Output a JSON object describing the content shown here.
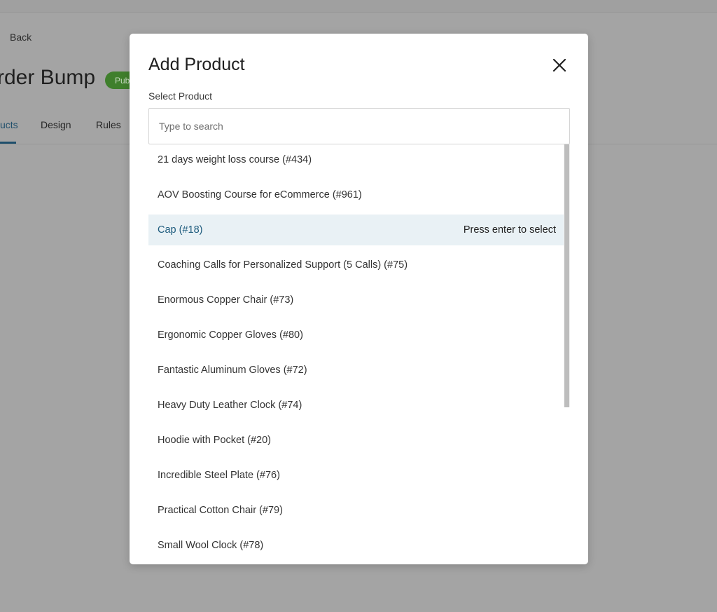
{
  "background": {
    "back_label": "Back",
    "page_title": "rder Bump",
    "status_badge": "Pub",
    "tabs": [
      {
        "label": "ucts"
      },
      {
        "label": "Design"
      },
      {
        "label": "Rules"
      }
    ]
  },
  "modal": {
    "title": "Add Product",
    "field_label": "Select Product",
    "search": {
      "placeholder": "Type to search",
      "value": ""
    },
    "highlight_hint": "Press enter to select",
    "results": [
      {
        "label": "21 days weight loss course (#434)"
      },
      {
        "label": "AOV Boosting Course for eCommerce (#961)"
      },
      {
        "label": "Cap (#18)"
      },
      {
        "label": "Coaching Calls for Personalized Support (5 Calls) (#75)"
      },
      {
        "label": "Enormous Copper Chair (#73)"
      },
      {
        "label": "Ergonomic Copper Gloves (#80)"
      },
      {
        "label": "Fantastic Aluminum Gloves (#72)"
      },
      {
        "label": "Heavy Duty Leather Clock (#74)"
      },
      {
        "label": "Hoodie with Pocket (#20)"
      },
      {
        "label": "Incredible Steel Plate (#76)"
      },
      {
        "label": "Practical Cotton Chair (#79)"
      },
      {
        "label": "Small Wool Clock (#78)"
      }
    ]
  },
  "icons": {
    "close": "close-icon"
  },
  "colors": {
    "overlay": "#a4a4a4",
    "accent": "#1d5b7d",
    "highlight_bg": "#e9f1f5",
    "badge_bg": "#3f7f2c"
  }
}
